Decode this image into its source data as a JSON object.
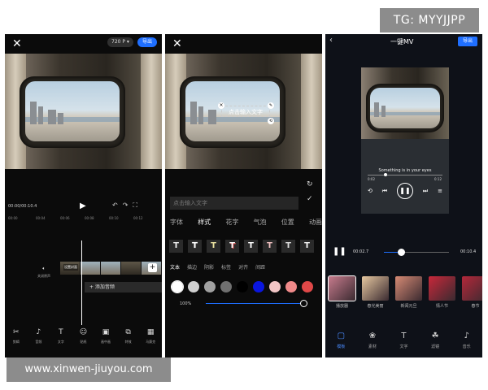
{
  "watermarks": {
    "tg": "TG: MYYJJPP",
    "site": "www.xinwen-jiuyou.com"
  },
  "panel1": {
    "resolution": "720 P",
    "export_label": "导出",
    "time": "00:00/00:10.4",
    "ruler_ticks": [
      "00:00",
      "00:04",
      "00:06",
      "00:08",
      "00:10",
      "00:12"
    ],
    "volume_label": "关闭原声",
    "cover_label": "设置封面",
    "add_audio": "+ 添加音频",
    "tools": [
      {
        "label": "剪辑",
        "icon": "scissors-icon"
      },
      {
        "label": "音频",
        "icon": "music-note-icon"
      },
      {
        "label": "文字",
        "icon": "text-icon"
      },
      {
        "label": "贴纸",
        "icon": "sticker-icon"
      },
      {
        "label": "画中画",
        "icon": "pip-icon"
      },
      {
        "label": "特效",
        "icon": "effects-icon"
      },
      {
        "label": "马赛克",
        "icon": "mosaic-icon"
      }
    ]
  },
  "panel2": {
    "text_chip": "点击输入文字",
    "input_placeholder": "点击输入文字",
    "tabs": [
      "字体",
      "样式",
      "花字",
      "气泡",
      "位置",
      "动画"
    ],
    "active_tab": "样式",
    "subtabs": [
      "文本",
      "描边",
      "阴影",
      "标签",
      "对齐",
      "间距"
    ],
    "active_subtab": "文本",
    "colors": [
      "#ffffff",
      "#d0d0d0",
      "#a0a0a0",
      "#707070",
      "#000000",
      "#0a16e0",
      "#f2c6c6",
      "#f08a8a",
      "#e04848"
    ],
    "opacity": "100%"
  },
  "panel3": {
    "title": "一键MV",
    "export_label": "导出",
    "lyric": "Something is in your eyes",
    "mini_start": "0:02",
    "mini_end": "0:12",
    "time_current": "00:02.7",
    "time_total": "00:10.4",
    "progress": 0.26,
    "templates": [
      {
        "label": "播放器",
        "color": "#c77b8d",
        "selected": true
      },
      {
        "label": "春光美丽",
        "color": "#e6c8a0",
        "selected": false
      },
      {
        "label": "新闻元旦",
        "color": "#d68a74",
        "selected": false
      },
      {
        "label": "情人节",
        "color": "#c8283a",
        "selected": false
      },
      {
        "label": "春节",
        "color": "#b3283a",
        "selected": false
      }
    ],
    "nav": [
      {
        "label": "模板",
        "icon": "template-icon",
        "active": true
      },
      {
        "label": "素材",
        "icon": "materials-icon",
        "active": false
      },
      {
        "label": "文字",
        "icon": "text-icon",
        "active": false
      },
      {
        "label": "滤镜",
        "icon": "filter-icon",
        "active": false
      },
      {
        "label": "音乐",
        "icon": "music-icon",
        "active": false
      }
    ]
  }
}
